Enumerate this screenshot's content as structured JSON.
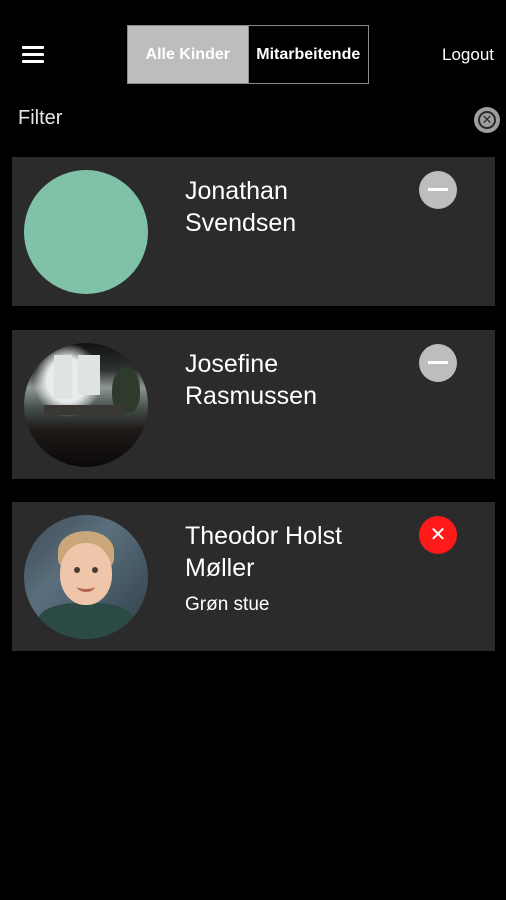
{
  "header": {
    "menu_icon": "hamburger-icon",
    "tabs": [
      {
        "label": "Alle Kinder",
        "active": true
      },
      {
        "label": "Mitarbeitende",
        "active": false
      }
    ],
    "logout_label": "Logout"
  },
  "filter": {
    "label": "Filter",
    "clear_icon": "clear-circle-icon"
  },
  "children": [
    {
      "first": "Jonathan",
      "last": "Svendsen",
      "group": "",
      "avatar": "placeholder",
      "avatar_color": "#80c2a8",
      "status_icon": "minus-circle-icon"
    },
    {
      "first": "Josefine",
      "last": "Rasmussen",
      "group": "",
      "avatar": "photo",
      "status_icon": "minus-circle-icon"
    },
    {
      "first": "Theodor Holst",
      "last": "Møller",
      "group": "Grøn stue",
      "avatar": "photo",
      "status_icon": "close-circle-icon",
      "status_glyph": "✕"
    }
  ],
  "colors": {
    "background": "#000000",
    "card": "#2b2b2b",
    "active_tab": "#bdbdbd",
    "status_neutral": "#bdbdbd",
    "status_absent": "#ff1a1a"
  }
}
